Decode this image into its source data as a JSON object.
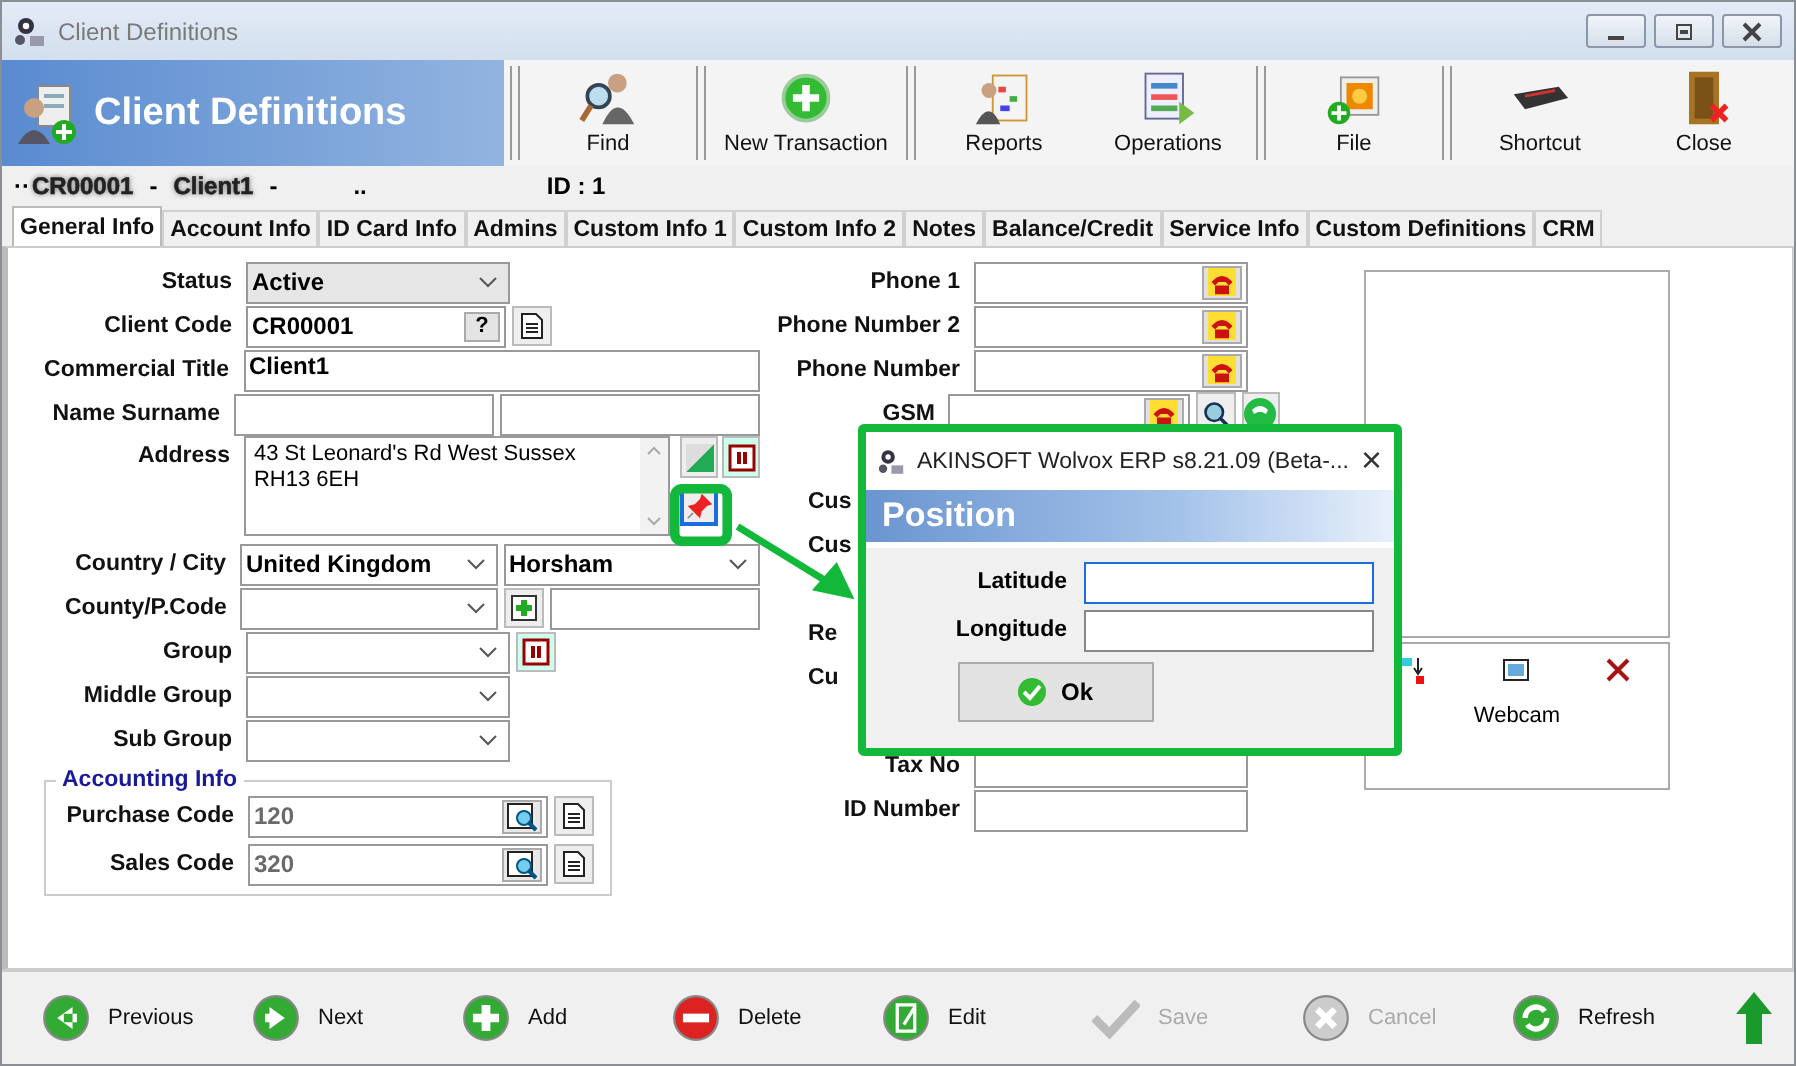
{
  "window": {
    "title": "Client Definitions"
  },
  "header": {
    "title": "Client Definitions"
  },
  "toolbar": [
    {
      "label": "Find"
    },
    {
      "label": "New Transaction"
    },
    {
      "label": "Reports"
    },
    {
      "label": "Operations"
    },
    {
      "label": "File"
    },
    {
      "label": "Shortcut"
    },
    {
      "label": "Close"
    }
  ],
  "record_line": {
    "prefix": "··",
    "code": "CR00001",
    "dash_1": "-",
    "name": "Client1",
    "dash_2": "-",
    "dots": "..",
    "id": "ID : 1"
  },
  "tabs": [
    {
      "label": "General Info",
      "selected": true
    },
    {
      "label": "Account Info",
      "selected": false
    },
    {
      "label": "ID Card Info",
      "selected": false
    },
    {
      "label": "Admins",
      "selected": false
    },
    {
      "label": "Custom Info 1",
      "selected": false
    },
    {
      "label": "Custom Info 2",
      "selected": false
    },
    {
      "label": "Notes",
      "selected": false
    },
    {
      "label": "Balance/Credit",
      "selected": false
    },
    {
      "label": "Service Info",
      "selected": false
    },
    {
      "label": "Custom Definitions",
      "selected": false
    },
    {
      "label": "CRM",
      "selected": false
    }
  ],
  "left_form": [
    {
      "label": "Status",
      "kind": "select",
      "value": "Active"
    },
    {
      "label": "Client Code",
      "kind": "code",
      "value": "CR00001",
      "button": "?"
    },
    {
      "label": "Commercial Title",
      "kind": "wide",
      "value": "Client1"
    },
    {
      "label": "Name Surname",
      "kind": "pair"
    },
    {
      "label": "Address",
      "kind": "address",
      "value": "43 St Leonard's Rd  West Sussex\nRH13 6EH"
    },
    {
      "label": "Country / City",
      "kind": "select_pair",
      "value": "United Kingdom",
      "value_2": "Horsham"
    },
    {
      "label": "County/P.Code",
      "kind": "select_add"
    },
    {
      "label": "Group",
      "kind": "select_btn"
    },
    {
      "label": "Middle Group",
      "kind": "select"
    },
    {
      "label": "Sub Group",
      "kind": "select"
    }
  ],
  "accounting": {
    "title": "Accounting Info",
    "rows": [
      {
        "label": "Purchase Code",
        "value": "120"
      },
      {
        "label": "Sales Code",
        "value": "320"
      }
    ]
  },
  "right_form": [
    {
      "label": "Phone 1",
      "kind": "phone"
    },
    {
      "label": "Phone Number 2",
      "kind": "phone"
    },
    {
      "label": "Phone Number",
      "kind": "phone"
    },
    {
      "label": "GSM",
      "kind": "gsm"
    },
    {
      "kind": "covered"
    },
    {
      "label": "Cus",
      "kind": "partial"
    },
    {
      "label": "Cus",
      "kind": "partial"
    },
    {
      "kind": "covered"
    },
    {
      "label": "Re",
      "kind": "partial"
    },
    {
      "label": "Cu",
      "kind": "partial"
    },
    {
      "kind": "covered"
    },
    {
      "label": "Tax No",
      "kind": "text"
    },
    {
      "label": "ID Number",
      "kind": "text"
    }
  ],
  "photo_panel": {
    "webcam_label": "Webcam"
  },
  "dialog": {
    "title": "AKINSOFT Wolvox ERP s8.21.09 (Beta-...",
    "close": "×",
    "heading": "Position",
    "fields": [
      {
        "label": "Latitude",
        "focused": true
      },
      {
        "label": "Longitude",
        "focused": false
      }
    ],
    "ok": "Ok"
  },
  "bottom_bar": [
    {
      "label": "Previous",
      "disabled": false
    },
    {
      "label": "Next",
      "disabled": false
    },
    {
      "label": "Add",
      "disabled": false
    },
    {
      "label": "Delete",
      "disabled": false
    },
    {
      "label": "Edit",
      "disabled": false
    },
    {
      "label": "Save",
      "disabled": true
    },
    {
      "label": "Cancel",
      "disabled": true
    },
    {
      "label": "Refresh",
      "disabled": false
    }
  ]
}
